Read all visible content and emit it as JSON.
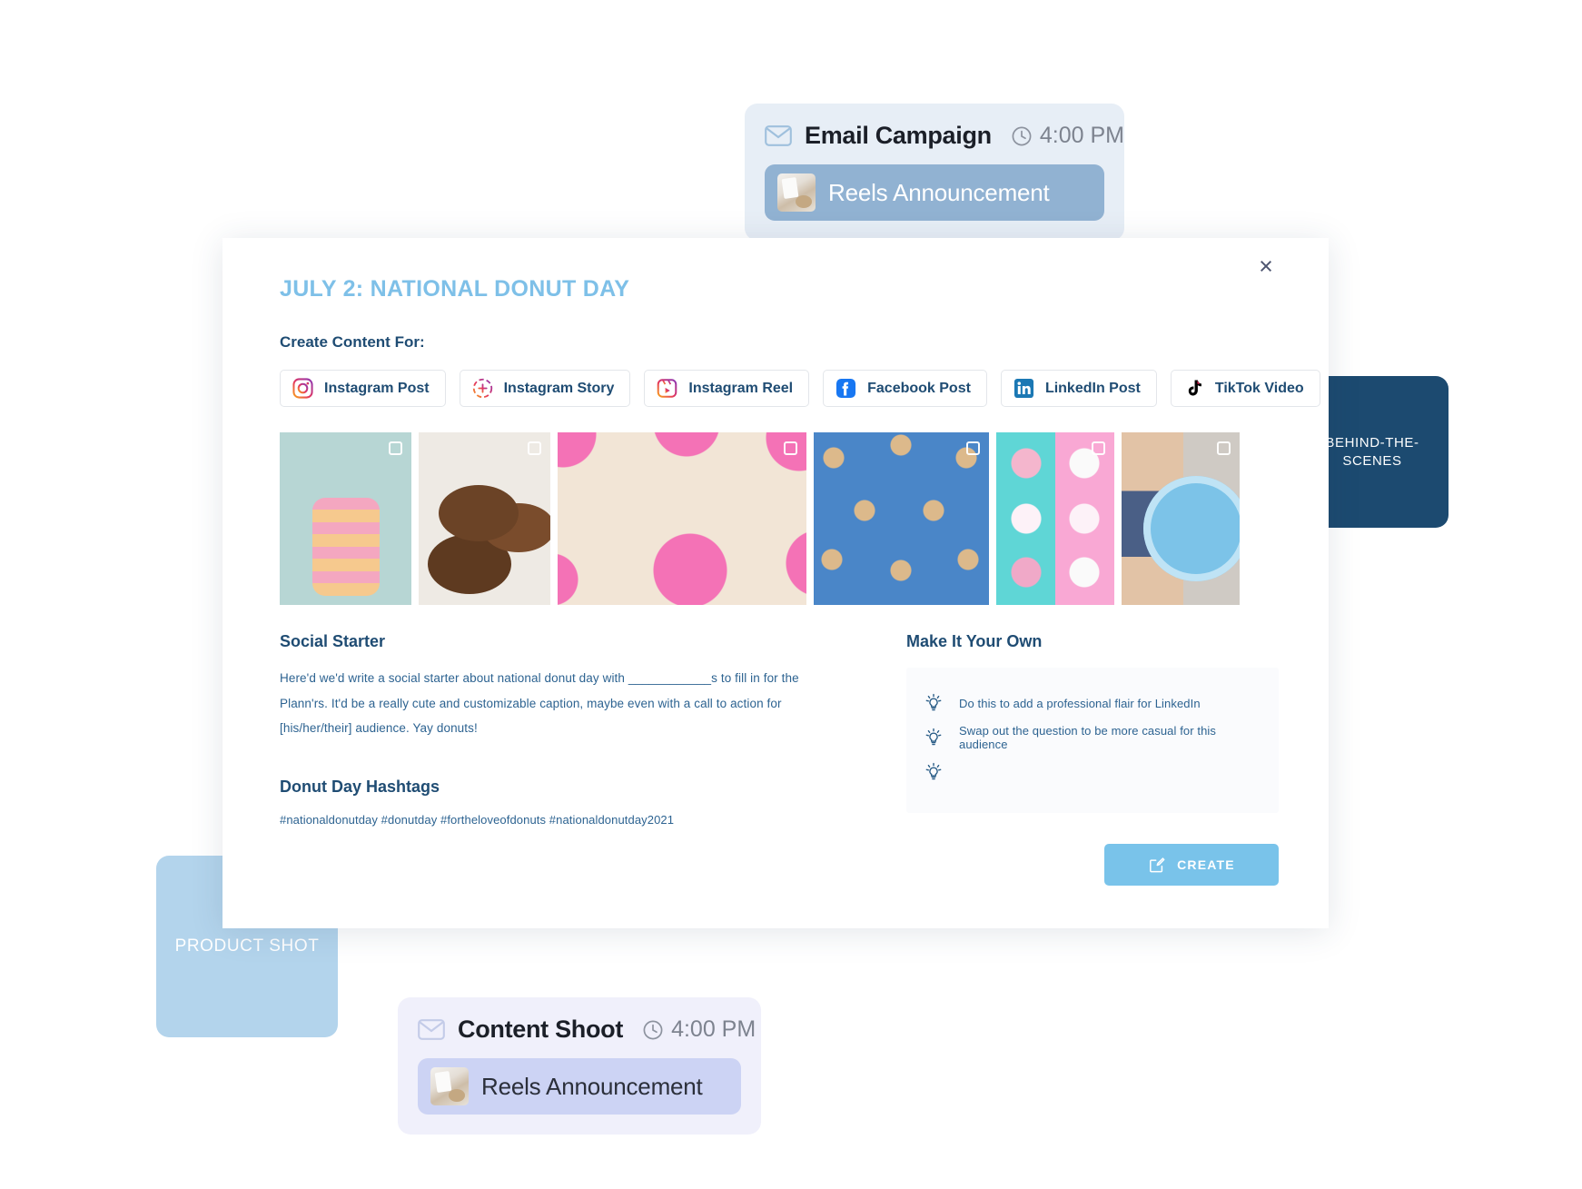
{
  "cards": [
    {
      "id": "email-campaign",
      "icon": "envelope-icon",
      "title": "Email Campaign",
      "time": "4:00 PM",
      "item_label": "Reels Announcement",
      "background": "#e7eef6",
      "pill_background": "#91b2d2"
    },
    {
      "id": "content-shoot",
      "icon": "envelope-icon",
      "title": "Content Shoot",
      "time": "4:00 PM",
      "item_label": "Reels Announcement",
      "background": "#f0f0fb",
      "pill_background": "#ccd3f4"
    }
  ],
  "tiles": [
    {
      "id": "behind-the-scenes",
      "label": "BEHIND-THE-SCENES",
      "color": "#1c4a70"
    },
    {
      "id": "product-shot",
      "label": "PRODUCT SHOT",
      "color": "#b3d4ec"
    }
  ],
  "panel": {
    "close_label": "×",
    "title": "JULY 2: NATIONAL DONUT DAY",
    "create_content_label": "Create Content For:",
    "title_color": "#7ec0e8",
    "heading_color": "#1f4c73",
    "platforms": [
      {
        "label": "Instagram Post",
        "icon": "instagram-icon"
      },
      {
        "label": "Instagram Story",
        "icon": "instagram-story-icon"
      },
      {
        "label": "Instagram Reel",
        "icon": "instagram-reel-icon"
      },
      {
        "label": "Facebook Post",
        "icon": "facebook-icon"
      },
      {
        "label": "LinkedIn Post",
        "icon": "linkedin-icon"
      },
      {
        "label": "TikTok Video",
        "icon": "tiktok-icon"
      }
    ],
    "thumbnails": [
      {
        "id": "stacked-pink-donuts",
        "selected": false
      },
      {
        "id": "chocolate-donuts",
        "selected": false
      },
      {
        "id": "pink-sprinkle-pattern",
        "selected": false
      },
      {
        "id": "blue-donut-pattern",
        "selected": false
      },
      {
        "id": "teal-pink-split-donuts",
        "selected": false
      },
      {
        "id": "child-with-donuts",
        "selected": false
      }
    ],
    "social_starter": {
      "heading": "Social Starter",
      "text": "Here'd we'd write a social starter about national donut day with ____________s to fill in for the Plann'rs. It'd be a really cute and customizable caption, maybe even with a call to action for [his/her/their] audience. Yay donuts!"
    },
    "hashtags": {
      "heading": "Donut Day Hashtags",
      "text": "#nationaldonutday #donutday #fortheloveofdonuts #nationaldonutday2021"
    },
    "make_it_your_own": {
      "heading": "Make It Your Own",
      "tips": [
        "Do this to add a professional flair for LinkedIn",
        "Swap out the question to be more casual for this audience",
        ""
      ]
    },
    "create_button": {
      "label": "CREATE",
      "icon": "pencil-edit-icon",
      "color": "#79c3ea"
    }
  }
}
